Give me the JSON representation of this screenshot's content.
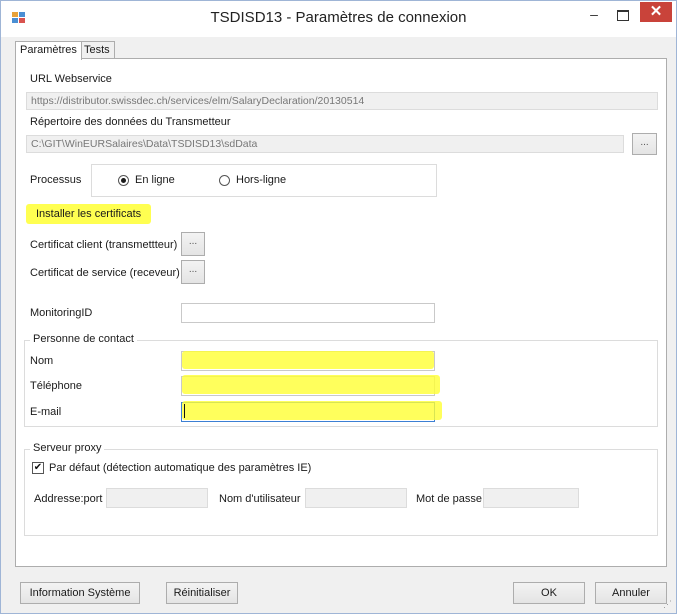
{
  "window": {
    "title": "TSDISD13 - Paramètres de connexion",
    "minimize_glyph": "–",
    "close_glyph": "✕"
  },
  "tabs": [
    {
      "label": "Paramètres",
      "active": true
    },
    {
      "label": "Tests",
      "active": false
    }
  ],
  "url_webservice": {
    "label": "URL Webservice",
    "value": "https://distributor.swissdec.ch/services/elm/SalaryDeclaration/20130514"
  },
  "repertoire": {
    "label": "Répertoire des données du Transmetteur",
    "value": "C:\\GIT\\WinEURSalaires\\Data\\TSDISD13\\sdData",
    "browse_label": "..."
  },
  "processus": {
    "label": "Processus",
    "options": [
      {
        "label": "En ligne",
        "selected": true
      },
      {
        "label": "Hors-ligne",
        "selected": false
      }
    ]
  },
  "install_certs_label": "Installer les certificats",
  "cert_client": {
    "label": "Certificat client (transmettteur)",
    "button_label": "..."
  },
  "cert_service": {
    "label": "Certificat de service (receveur)",
    "button_label": "..."
  },
  "monitoring": {
    "label": "MonitoringID",
    "value": ""
  },
  "contact": {
    "group_title": "Personne de contact",
    "nom": {
      "label": "Nom",
      "value": ""
    },
    "telephone": {
      "label": "Téléphone",
      "value": ""
    },
    "email": {
      "label": "E-mail",
      "value": ""
    }
  },
  "proxy": {
    "group_title": "Serveur proxy",
    "default_checkbox": {
      "label": "Par défaut (détection automatique des paramètres IE)",
      "checked": true,
      "glyph": "✔"
    },
    "address_label": "Addresse:port",
    "user_label": "Nom d'utilisateur",
    "password_label": "Mot de passe"
  },
  "footer": {
    "info_system": "Information Système",
    "reset": "Réinitialiser",
    "ok": "OK",
    "cancel": "Annuler"
  },
  "colors": {
    "highlight": "#ffff33",
    "close_button": "#c9433a"
  },
  "icons": [
    "app-icon",
    "minimize-icon",
    "maximize-icon",
    "close-icon",
    "browse-icon",
    "size-grip-icon"
  ]
}
